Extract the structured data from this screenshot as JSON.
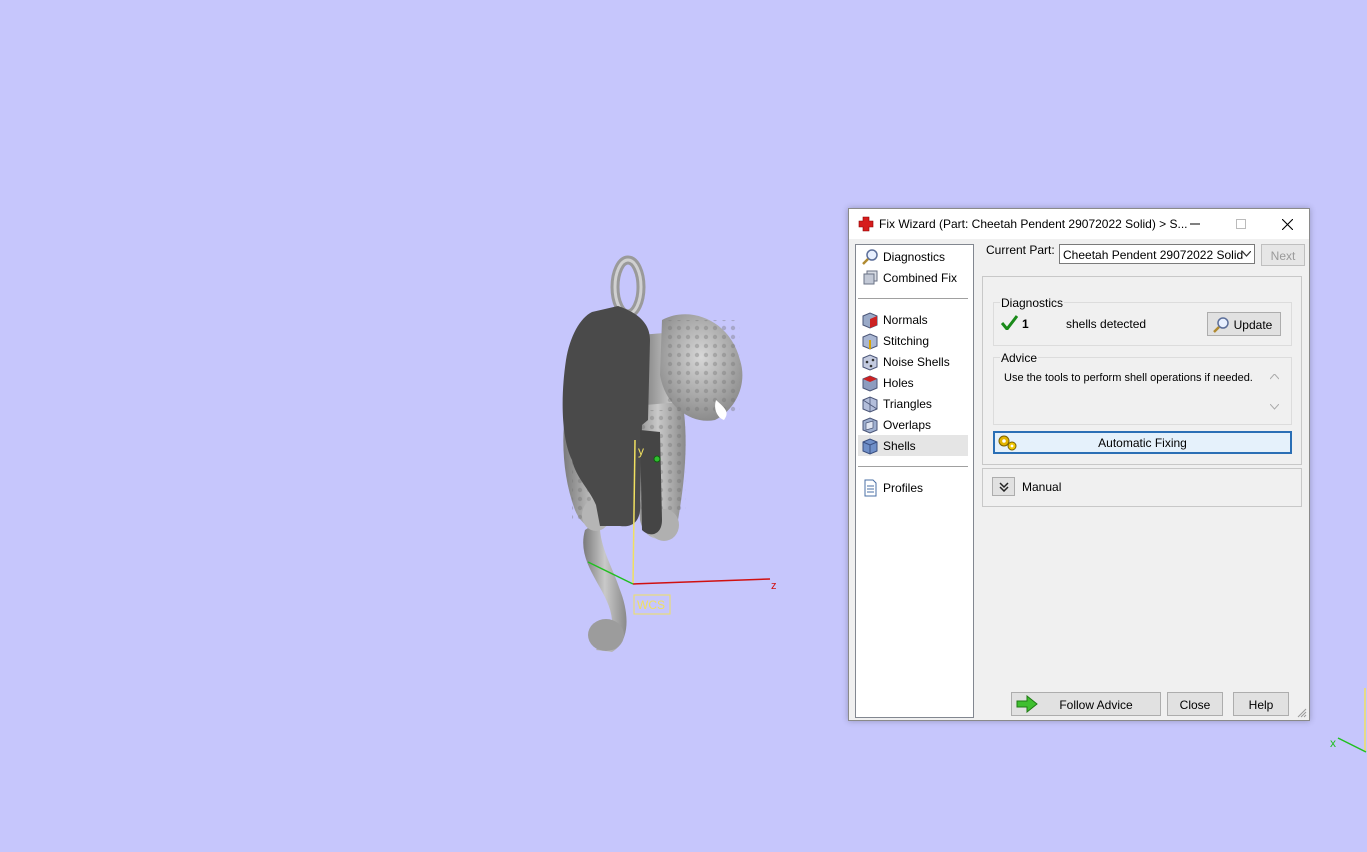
{
  "viewport": {
    "axis_labels": {
      "y": "y",
      "z": "z",
      "x_far": "x"
    },
    "wcs_label": "WCS",
    "colors": {
      "background": "#c6c6fc",
      "z_axis": "#d01010",
      "y_axis": "#f0e060",
      "x_axis": "#20c020"
    }
  },
  "dialog": {
    "title": "Fix Wizard (Part: Cheetah Pendent 29072022 Solid) > S...",
    "nav": {
      "top": [
        {
          "label": "Diagnostics",
          "icon": "magnifier-icon"
        },
        {
          "label": "Combined Fix",
          "icon": "stack-icon"
        }
      ],
      "tools": [
        {
          "label": "Normals",
          "icon": "normals-cube-icon"
        },
        {
          "label": "Stitching",
          "icon": "stitching-cube-icon"
        },
        {
          "label": "Noise Shells",
          "icon": "noise-shells-icon"
        },
        {
          "label": "Holes",
          "icon": "holes-cube-icon"
        },
        {
          "label": "Triangles",
          "icon": "triangles-cube-icon"
        },
        {
          "label": "Overlaps",
          "icon": "overlaps-cube-icon"
        },
        {
          "label": "Shells",
          "icon": "shells-cube-icon",
          "selected": true
        }
      ],
      "bottom": [
        {
          "label": "Profiles",
          "icon": "document-icon"
        }
      ]
    },
    "current_part_label": "Current Part:",
    "current_part_value": "Cheetah Pendent 29072022 Solid",
    "next_label": "Next",
    "diagnostics": {
      "group_label": "Diagnostics",
      "count": "1",
      "text": "shells detected",
      "update_label": "Update"
    },
    "advice": {
      "group_label": "Advice",
      "text": "Use the tools to perform shell operations if needed."
    },
    "automatic_fixing_label": "Automatic Fixing",
    "manual_label": "Manual",
    "footer": {
      "follow_advice_label": "Follow Advice",
      "close_label": "Close",
      "help_label": "Help"
    }
  }
}
